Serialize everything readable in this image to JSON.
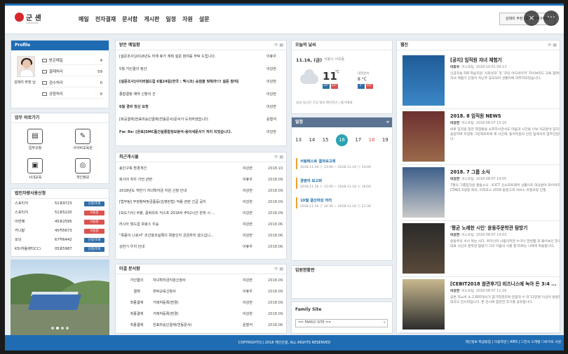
{
  "header": {
    "logo_text": "군 셴",
    "logo_sub": "GUNSHEN",
    "nav": [
      "메일",
      "전자결재",
      "문서함",
      "게시판",
      "일정",
      "자원",
      "설문"
    ],
    "user_box": "김태리 부장 (종합)외주구매팀",
    "close_icon": "×",
    "more_icon": "⋯"
  },
  "profile": {
    "title": "Profile",
    "name": "김태리 부장 님",
    "rows": [
      {
        "label": "받은메일",
        "count": "4"
      },
      {
        "label": "결재처리",
        "count": "59"
      },
      {
        "label": "검수처리",
        "count": "0"
      },
      {
        "label": "공람처리",
        "count": "0"
      }
    ]
  },
  "shortcuts": {
    "title": "업무 바로가기",
    "items": [
      "업무규정",
      "사이버교육원",
      "사내교육",
      "개인정보"
    ]
  },
  "car": {
    "title": "법인차량사용신청",
    "rows": [
      {
        "car": "스포티지",
        "plate": "51호9723",
        "status": "신청/조회",
        "color": "#2f6ea7"
      },
      {
        "car": "스포티지",
        "plate": "51호5220",
        "status": "사용중",
        "color": "#d9534f"
      },
      {
        "car": "아반떼",
        "plate": "45호2595",
        "status": "사용중",
        "color": "#d9534f"
      },
      {
        "car": "카니발",
        "plate": "45허5673",
        "status": "사용중",
        "color": "#d9534f"
      },
      {
        "car": "모닝",
        "plate": "67허6442",
        "status": "신청/조회",
        "color": "#2f6ea7"
      },
      {
        "car": "K5(하톨렛티CC)",
        "plate": "05호5987",
        "status": "신청/조회",
        "color": "#2f6ea7"
      }
    ]
  },
  "approval": {
    "title": "받은 메일함",
    "rows": [
      {
        "title": "[설문조사]2018년도 하계 휴가 계획 설문 참여를 부탁 드립니다.",
        "author": "이휴우",
        "date": ""
      },
      {
        "title": "5월 거인결의 정산",
        "author": "이강한",
        "date": ""
      },
      {
        "title": "[설문조사]사이버월드컵 6월24일(한국 : 멕시코) 승점을 맞춰라!!! 설문 참여를 ...",
        "author": "이강한",
        "date": ""
      },
      {
        "title": "종합결정 예약 신청의 건",
        "author": "이강한",
        "date": ""
      },
      {
        "title": "6월 경비 정산 요청",
        "author": "이강한",
        "date": ""
      },
      {
        "title": "[화공결재]전표마승인결재(연동문서)문서가 도착하였습니다.",
        "author": "윤형석",
        "date": ""
      },
      {
        "title": "Fw: Re: [완료]SMC품건설종합정보분석-용의세문서가 처리 되었습니다.",
        "author": "이강한",
        "date": ""
      }
    ]
  },
  "board": {
    "title": "최근게시물",
    "rows": [
      {
        "title": "송인구축 환경개선",
        "author": "이강한",
        "date": "2018.10.01"
      },
      {
        "title": "회사의 처우 가전 관련",
        "author": "이휴우",
        "date": "2018.09.28"
      },
      {
        "title": "2018년도 하반기 자녀학자금 지원 신청 안내",
        "author": "이강한",
        "date": "2018.09.14"
      },
      {
        "title": "[법무팀] 부정청탁및금품등(김영란법) 적용 관련 긴급 공지",
        "author": "이강한",
        "date": "2018.09.14"
      },
      {
        "title": "[보도기사] 쿠팡, 중화유트 익스프 2018서 주52시간 완착 시 ...",
        "author": "이강한",
        "date": "2018.09.14"
      },
      {
        "title": "러시아 월드컵 프랑스 우승",
        "author": "이강한",
        "date": "2018.06.29"
      },
      {
        "title": "\"폭풍이 니로서\" 조선왕조실록이 목말인지 궁금하지 않으십니...",
        "author": "이강한",
        "date": "2018.06.29"
      },
      {
        "title": "상반기 우치 안내",
        "author": "이휴우",
        "date": "2018.06.29"
      }
    ]
  },
  "pending": {
    "title": "미결 문서함",
    "rows": [
      {
        "type": "가인협의",
        "title": "자녀학자금지원신청서",
        "author": "이강한",
        "date": "2018.09.18"
      },
      {
        "type": "결재",
        "title": "위탁교육신청서",
        "author": "이휴우",
        "date": "2018.09.18"
      },
      {
        "type": "최종결재",
        "title": "거래처등록(변경)",
        "author": "이강한",
        "date": "2018.09.10"
      },
      {
        "type": "최종결재",
        "title": "거래처등록(변경)",
        "author": "이강한",
        "date": "2018.09.10"
      },
      {
        "type": "최종결재",
        "title": "전표마승인결재(연동문서)",
        "author": "윤형석",
        "date": "2018.06.22"
      }
    ]
  },
  "weather": {
    "title": "오늘의 날씨",
    "date": "11.16, (금)",
    "location": "서울시 서초동",
    "temp": "11",
    "unit": "°C",
    "high": "12°",
    "low": "10°",
    "tomorrow_label": "내일날씨",
    "tomorrow_temp": "8 °C",
    "tomorrow_low": "5°",
    "tomorrow_high": "10°",
    "note": "날씨 실시간 기상 정보 확인하기 | 출기에세"
  },
  "schedule": {
    "title": "일정",
    "days": [
      {
        "d": "13",
        "color": "#333"
      },
      {
        "d": "14",
        "color": "#333"
      },
      {
        "d": "15",
        "color": "#333"
      },
      {
        "d": "16",
        "color": "#fff"
      },
      {
        "d": "17",
        "color": "#333"
      },
      {
        "d": "18",
        "color": "#e0534c"
      },
      {
        "d": "19",
        "color": "#333"
      }
    ],
    "items": [
      {
        "title": "서림테스트 결과보고회",
        "time": "2018.11.16 ⓢ 13:00 ~ 2018.11.16 ⓢ 14:00"
      },
      {
        "title": "경영자 보고회",
        "time": "2018.11.16 ⓢ 15:00 ~ 2018.11.16 ⓢ 16:00"
      },
      {
        "title": "10월 결산마감 처리",
        "time": "2018.11.16 ⓢ 10:30 ~ 2018.11.16 ⓢ 11:30"
      }
    ]
  },
  "members": {
    "title": "임원현황판"
  },
  "family": {
    "title": "Family Site",
    "select": "== FAMILY SITE =="
  },
  "news": {
    "title": "웹진",
    "items": [
      {
        "title": "[공지] 임직원 자녀 체험기",
        "author": "이휴우",
        "team": "마스트팀",
        "date": "2018-10-01 09:13",
        "body": "인공지능 SW 학습지원 '사회성과' 및 '코딩 어드바이저' 하이브리드 교육 참여로 자녀 체험기 신청이 지난주 공모되어 성황리에 마무리되었습니다."
      },
      {
        "title": "2018. 8 임직원 NEWS",
        "author": "이강한",
        "team": "마스트팀",
        "date": "2018-08-07 15:16",
        "body": "바로 임직원 업관 학업활용 소회하시면서도 마음과 시간을 나눠 자교분야 임직원 응원하며 지원해 그린맥포트에 제 시간에, 동아리원의 안전 팀에서의 업무간입니다."
      },
      {
        "title": "2018. 7 그룹 소식",
        "author": "이강한",
        "team": "마스트팀",
        "date": "2018-08-07 14:05",
        "body": "7월의 그룹입직원 활동소식 · K-ICT 신소프트웨어 상품이오 대상받아 와이어즈 CDW1.5생정 회의, 미적포스 2018 방문고객 서비스 유형과정 진행"
      },
      {
        "title": "'평균 노래한 시인' 윤동주문학관 탐방기",
        "author": "이강한",
        "team": "마스트팀",
        "date": "2018-08-07 14:03",
        "body": "윤동주의 서시 위는 시다. 우리나라 사람이라면 누구나 한번쯤 꼭 들어보신 한국 대표 시인의 문학관 탐방기 그의 이름의 시를 잘 따르는 나에게 학술합니다."
      },
      {
        "title": "[CEBIT2018 참관후기] 비즈니스에 녹아 든 3:4 ...",
        "author": "이강한",
        "team": "마스트팀",
        "date": "2018-08-07 11:39",
        "body": "공변 하노버 소 2,800개사가 참가하였으며 관람객 수 약 12만명 이상이 방문한 대규모 전시회입니다. 본 전시에 참관한 후기를 공유합니다."
      }
    ]
  },
  "footer": {
    "copyright": "COPYRIGHT(C) 2018 캐인건설, ALL RIGHTS RESERVED",
    "links": "개인정보 취급방침 | 이용약관 | AIRS | ☐전사 ☑개발 ☐바이오 사원"
  }
}
